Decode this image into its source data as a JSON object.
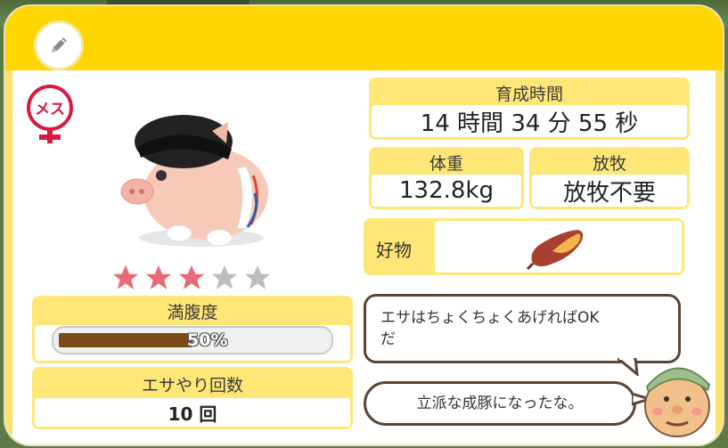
{
  "header": {
    "edit_icon": "pencil-icon",
    "colors": {
      "header": "#ffd600",
      "card": "#ffe777",
      "bubble_border": "#5a4636"
    }
  },
  "pig": {
    "gender_label": "メス",
    "rating": 3,
    "rating_max": 5,
    "fullness": {
      "label": "満腹度",
      "value_text": "50%",
      "percent": 50
    },
    "feed_count": {
      "label": "エサやり回数",
      "value": "10 回"
    }
  },
  "stats": {
    "growth_time": {
      "label": "育成時間",
      "value": "14 時間 34 分 55 秒"
    },
    "weight": {
      "label": "体重",
      "value": "132.8kg"
    },
    "grazing": {
      "label": "放牧",
      "value": "放牧不要"
    },
    "favorite": {
      "label": "好物",
      "item_icon": "sweet-potato-icon"
    }
  },
  "dialogue": {
    "line1": "エサはちょくちょくあげればOK\nだ",
    "line2": "立派な成豚になったな。"
  }
}
